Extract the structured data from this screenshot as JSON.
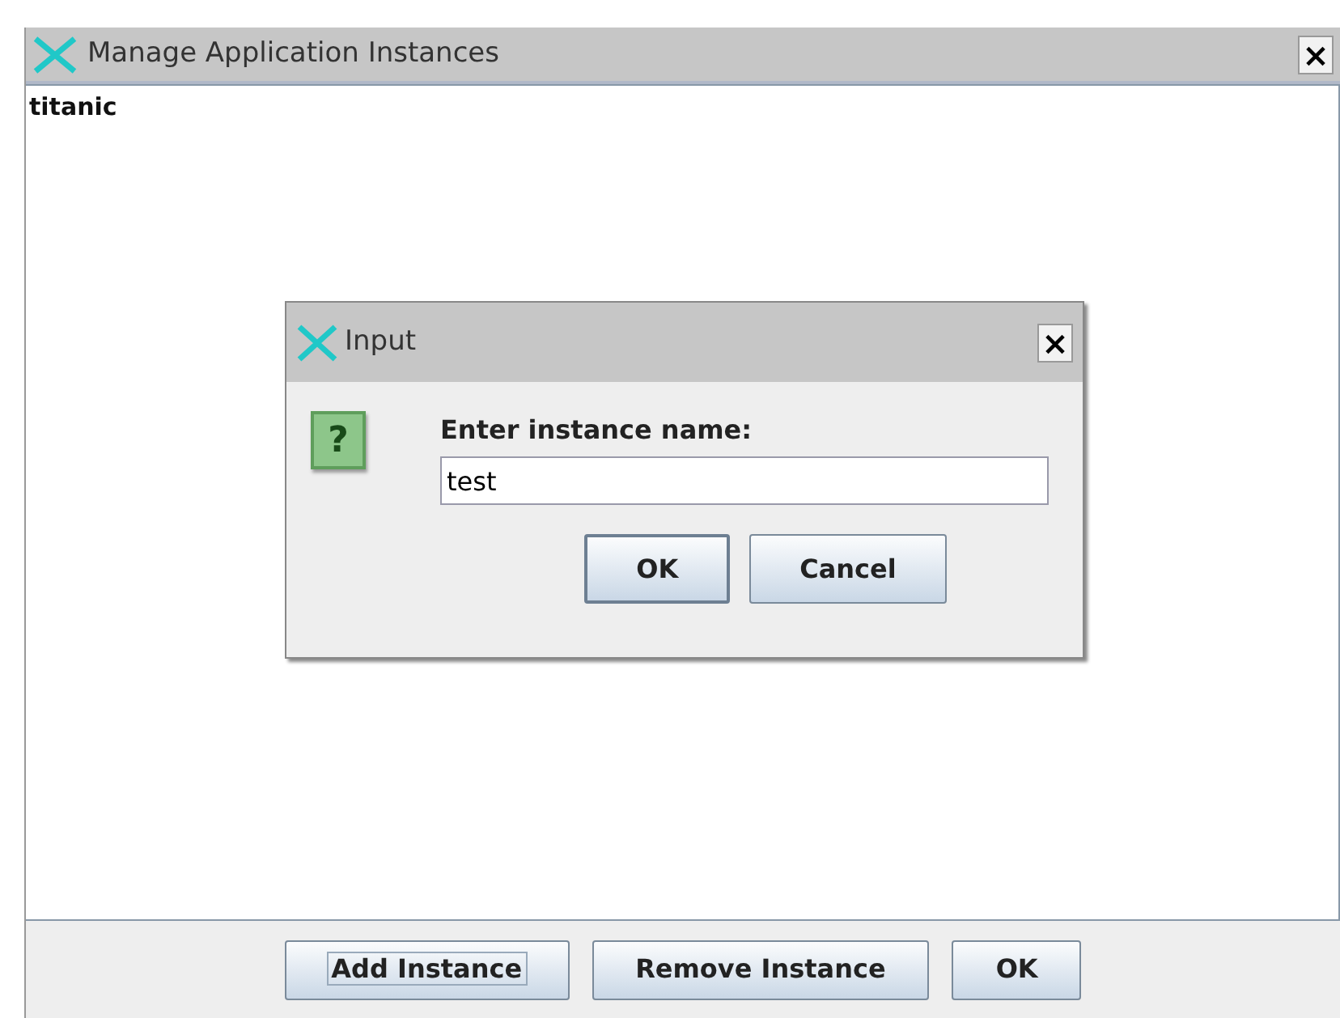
{
  "window": {
    "title": "Manage Application Instances",
    "close": "×"
  },
  "list": {
    "items": [
      {
        "label": "titanic",
        "selected": false
      }
    ]
  },
  "buttons": [
    {
      "label": "Add Instance",
      "focused": true
    },
    {
      "label": "Remove Instance",
      "focused": false
    },
    {
      "label": "OK",
      "focused": false
    }
  ],
  "dialog": {
    "title": "Input",
    "close": "×",
    "icon": "?",
    "prompt": "Enter instance name:",
    "value": "test",
    "buttons": [
      {
        "label": "OK",
        "focused": true
      },
      {
        "label": "Cancel",
        "focused": false
      }
    ]
  }
}
